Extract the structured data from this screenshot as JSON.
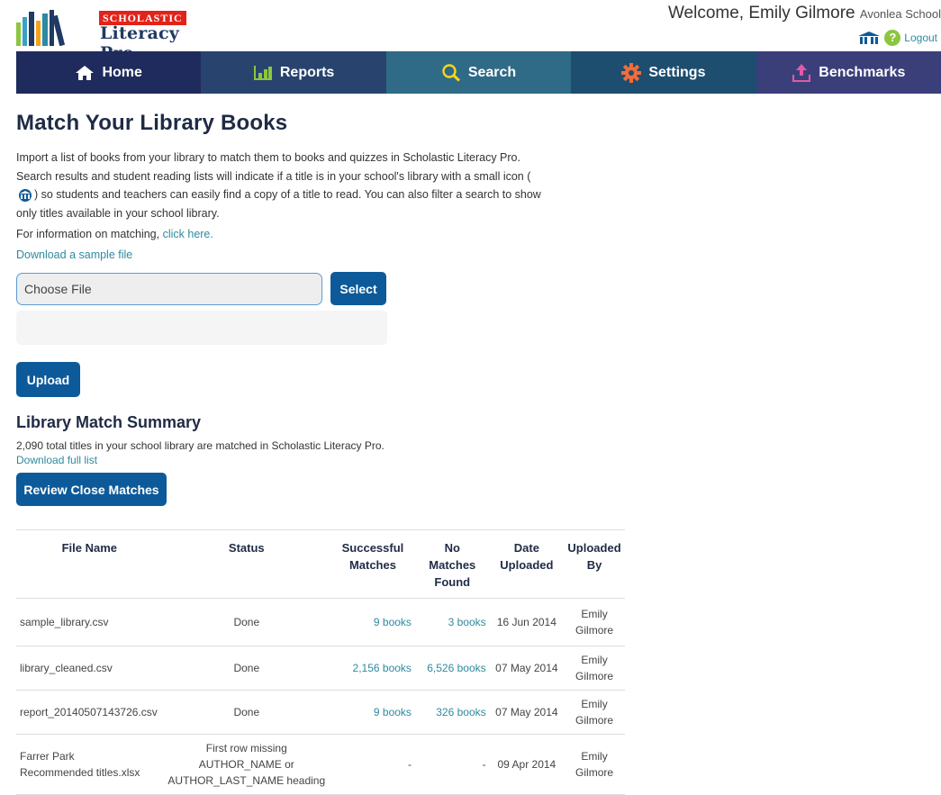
{
  "brand": {
    "badge": "SCHOLASTIC",
    "product": "Literacy Pro",
    "colors": {
      "nav_home": "#1f2b5c",
      "nav_reports": "#28446e",
      "nav_search": "#2f6a86",
      "nav_settings": "#1d4e70",
      "nav_benchmarks": "#3a3f7a",
      "accent": "#2e8aa0",
      "button": "#0d5a9a"
    }
  },
  "header": {
    "welcome": "Welcome, Emily Gilmore",
    "school": "Avonlea School",
    "logout": "Logout"
  },
  "nav": [
    {
      "label": "Home",
      "icon": "home-icon"
    },
    {
      "label": "Reports",
      "icon": "bar-chart-icon"
    },
    {
      "label": "Search",
      "icon": "magnifier-icon"
    },
    {
      "label": "Settings",
      "icon": "gear-icon"
    },
    {
      "label": "Benchmarks",
      "icon": "upload-arrow-icon"
    }
  ],
  "page": {
    "title": "Match Your Library Books",
    "intro_1": "Import a list of books from your library to match them to books and quizzes in Scholastic Literacy Pro. Search results and student reading lists will indicate if a title is in your school's library with a small icon (",
    "intro_2": ") so students and teachers can easily find a copy of a title to read. You can also filter a search to show only titles available in your school library.",
    "info_prefix": "For information on matching,",
    "info_link": "click here.",
    "sample_link": "Download a sample file",
    "file_placeholder": "Choose File",
    "select_label": "Select",
    "upload_label": "Upload"
  },
  "summary": {
    "heading": "Library Match Summary",
    "text": "2,090 total titles in your school library are matched in Scholastic Literacy Pro.",
    "download_full": "Download full list",
    "review_label": "Review Close Matches"
  },
  "table": {
    "headers": {
      "file_name": "File Name",
      "status": "Status",
      "successful_1": "Successful",
      "successful_2": "Matches",
      "nomatch_1": "No",
      "nomatch_2": "Matches",
      "nomatch_3": "Found",
      "date_1": "Date",
      "date_2": "Uploaded",
      "by_1": "Uploaded",
      "by_2": "By"
    },
    "rows": [
      {
        "file_a": "sample_library.csv",
        "file_b": "",
        "status_a": "Done",
        "status_b": "",
        "successful": "9 books",
        "no_matches": "3 books",
        "date": "16 Jun 2014",
        "by_a": "Emily",
        "by_b": "Gilmore"
      },
      {
        "file_a": "library_cleaned.csv",
        "file_b": "",
        "status_a": "Done",
        "status_b": "",
        "successful": "2,156 books",
        "no_matches": "6,526 books",
        "date": "07 May 2014",
        "by_a": "Emily",
        "by_b": "Gilmore"
      },
      {
        "file_a": "report_20140507143726.csv",
        "file_b": "",
        "status_a": "Done",
        "status_b": "",
        "successful": "9 books",
        "no_matches": "326 books",
        "date": "07 May 2014",
        "by_a": "Emily",
        "by_b": "Gilmore"
      },
      {
        "file_a": "Farrer Park",
        "file_b": "Recommended titles.xlsx",
        "status_a": "First row missing AUTHOR_NAME or",
        "status_b": "AUTHOR_LAST_NAME heading",
        "successful": "-",
        "no_matches": "-",
        "date": "09 Apr 2014",
        "by_a": "Emily",
        "by_b": "Gilmore"
      }
    ]
  }
}
